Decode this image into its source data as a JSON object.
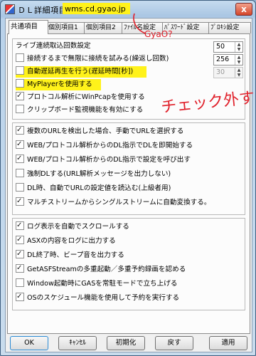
{
  "window": {
    "title": "ＤＬ詳細項目設定",
    "domain": "wms.cd.gyao.jp",
    "close_label": "x"
  },
  "tabs": [
    {
      "label": "共通項目"
    },
    {
      "label": "個別項目1"
    },
    {
      "label": "個別項目2"
    },
    {
      "label": "ﾌｧｲﾙ名設定"
    },
    {
      "label": "ﾊﾟｽﾜｰﾄﾞ設定"
    },
    {
      "label": "ﾌﾟﾛｷｼ設定"
    }
  ],
  "group1": {
    "rows": [
      {
        "label": "ライブ連続取込回数設定",
        "checkbox": false,
        "spin_value": "50"
      },
      {
        "label": "接続するまで無限に接続を試みる(繰返し回数)",
        "checkbox": true,
        "checked": false,
        "spin_value": "256"
      },
      {
        "label": "自動遅延再生を行う(遅延時間[秒])",
        "checkbox": true,
        "checked": false,
        "spin_value": "30",
        "disabled": true,
        "highlight": true
      },
      {
        "label": "MyPlayerを使用する",
        "checkbox": true,
        "checked": false,
        "highlight": true
      },
      {
        "label": "プロトコル解析にWinPcapを使用する",
        "checkbox": true,
        "checked": true
      },
      {
        "label": "クリップボード監視機能を有効にする",
        "checkbox": true,
        "checked": false
      }
    ]
  },
  "group2": {
    "rows": [
      {
        "label": "複数のURLを検出した場合、手動でURLを選択する",
        "checked": true
      },
      {
        "label": "WEB/プロトコル解析からのDL指示でDLを即開始する",
        "checked": true
      },
      {
        "label": "WEB/プロトコル解析からのDL指示で設定を呼び出す",
        "checked": true
      },
      {
        "label": "強制DLする(URL解析メッセージを出力しない)",
        "checked": false
      },
      {
        "label": "DL時、自動でURLの設定値を読込む(上級者用)",
        "checked": false
      },
      {
        "label": "マルチストリームからシングルストリームに自動変換する。",
        "checked": true
      }
    ]
  },
  "group3": {
    "rows": [
      {
        "label": "ログ表示を自動でスクロールする",
        "checked": true
      },
      {
        "label": "ASXの内容をログに出力する",
        "checked": true
      },
      {
        "label": "DL終了時、ビープ音を出力する",
        "checked": true
      },
      {
        "label": "GetASFStreamの多重起動／多重予約録画を認める",
        "checked": true
      },
      {
        "label": "Window起動時にGASを常駐モードで立ち上げる",
        "checked": false
      },
      {
        "label": "OSのスケジュール機能を使用して予約を実行する",
        "checked": true
      }
    ]
  },
  "buttons": {
    "ok": "OK",
    "cancel": "ｷｬﾝｾﾙ",
    "reset": "初期化",
    "back": "戻す",
    "apply": "適用"
  },
  "annotations": {
    "gyao": "GyaO?",
    "check": "チェック外す"
  },
  "colors": {
    "highlight": "#fff21a",
    "annotation": "#e0202a"
  }
}
